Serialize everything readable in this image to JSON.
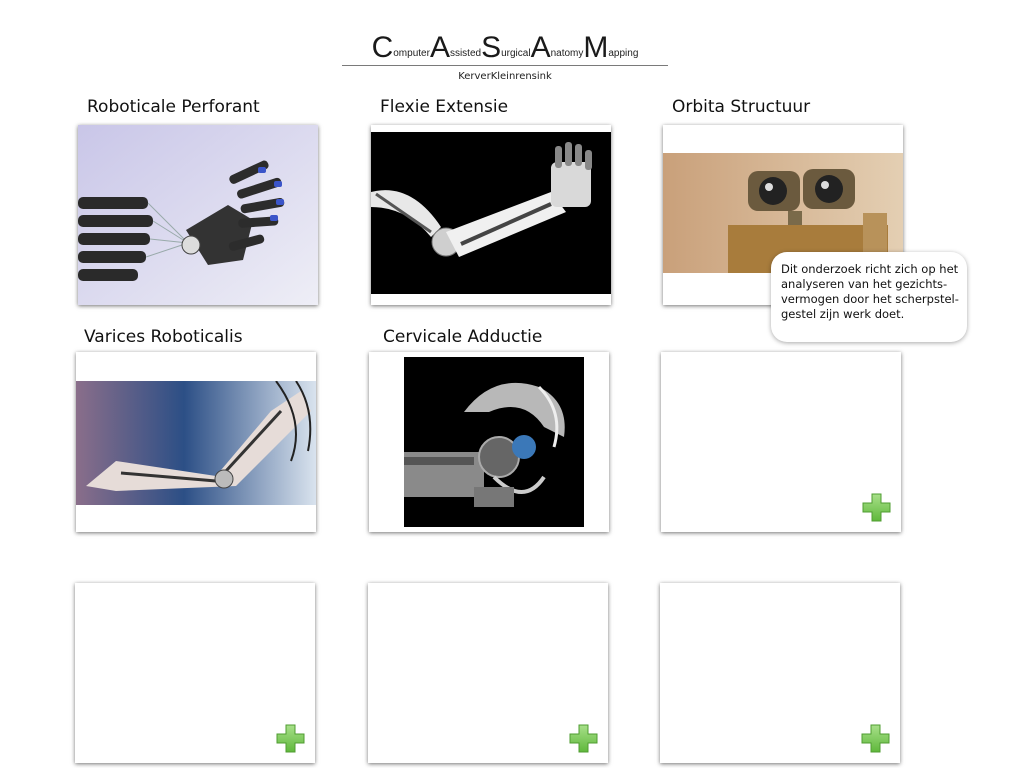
{
  "logo": {
    "words": [
      {
        "cap": "C",
        "rest": "omputer"
      },
      {
        "cap": "A",
        "rest": "ssisted"
      },
      {
        "cap": "S",
        "rest": "urgical"
      },
      {
        "cap": "A",
        "rest": "natomy"
      },
      {
        "cap": "M",
        "rest": "apping"
      }
    ],
    "subtitle": "KerverKleinrensink"
  },
  "tiles": [
    {
      "title": "Roboticale Perforant",
      "image": "robotic-hand-photo"
    },
    {
      "title": "Flexie Extensie",
      "image": "robotic-arm-photo"
    },
    {
      "title": "Orbita Structuur",
      "image": "wall-e-robot-photo"
    },
    {
      "title": "Varices Roboticalis",
      "image": "robotic-leg-photo"
    },
    {
      "title": "Cervicale Adductie",
      "image": "robotic-head-photo"
    },
    {
      "title": "",
      "add_icon": "plus-icon"
    },
    {
      "title": "",
      "add_icon": "plus-icon"
    },
    {
      "title": "",
      "add_icon": "plus-icon"
    },
    {
      "title": "",
      "add_icon": "plus-icon"
    }
  ],
  "tooltip": {
    "lines": [
      "Dit onderzoek richt zich op het",
      "analyseren van het gezichts-",
      "vermogen door het scherpstel-",
      "gestel zijn werk doet."
    ]
  },
  "colors": {
    "plus_green": "#7ecb5a",
    "tile_border_shadow": "#555555"
  }
}
